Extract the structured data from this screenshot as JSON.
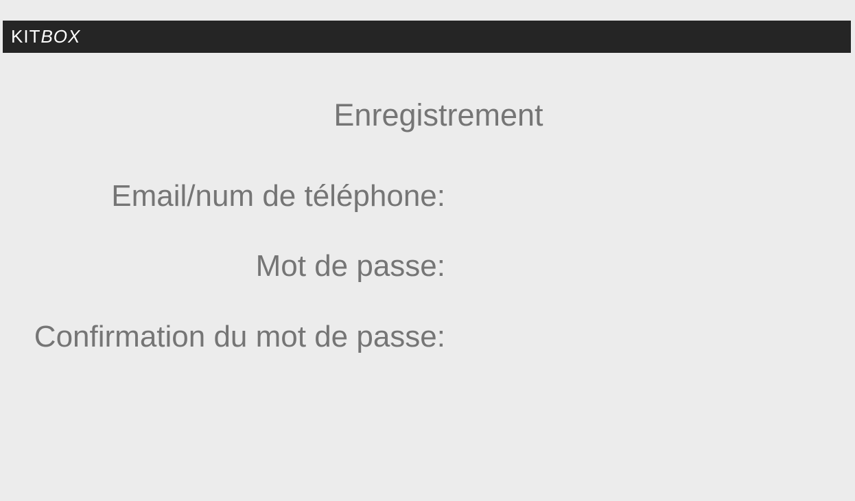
{
  "header": {
    "brand_main": "KIT",
    "brand_italic": "BOX"
  },
  "page": {
    "title": "Enregistrement"
  },
  "form": {
    "email_label": "Email/num de téléphone:",
    "email_value": "",
    "password_label": "Mot de passe:",
    "password_value": "",
    "confirm_label": "Confirmation du mot de passe:",
    "confirm_value": ""
  },
  "colors": {
    "background": "#ececec",
    "topbar": "#252525",
    "text": "#757575"
  }
}
